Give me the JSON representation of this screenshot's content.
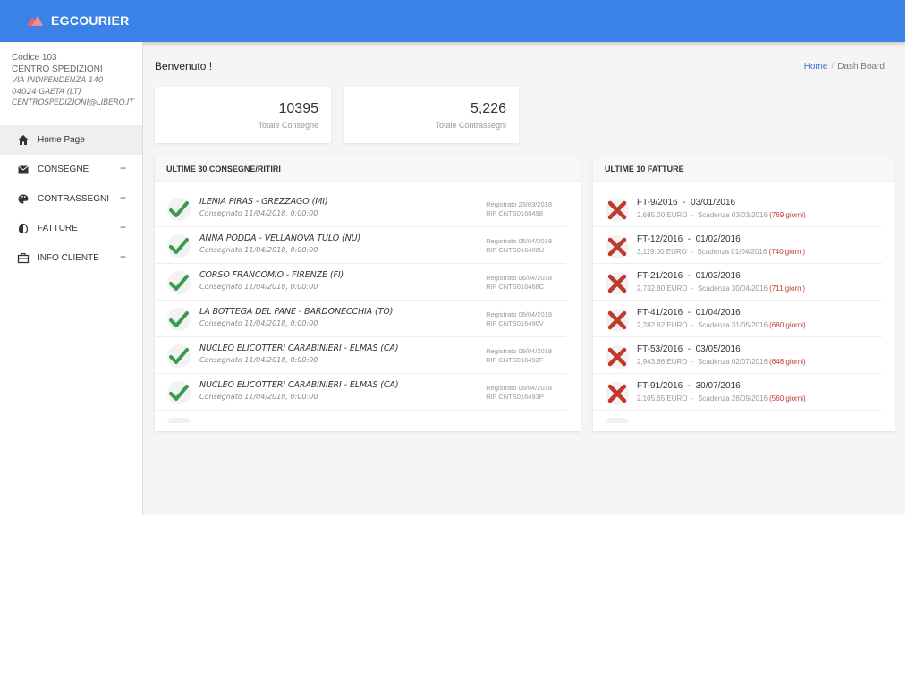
{
  "header": {
    "brand": "EGCOURIER"
  },
  "client": {
    "code": "Codice 103",
    "name": "CENTRO SPEDIZIONI",
    "address": "VIA INDIPENDENZA 140",
    "city": "04024 GAETA (LT)",
    "email": "CENTROSPEDIZIONI@LIBERO.IT"
  },
  "sidebar": {
    "items": [
      {
        "label": "Home Page",
        "icon": "home-icon",
        "expandable": false
      },
      {
        "label": "CONSEGNE",
        "icon": "envelope-icon",
        "expandable": true,
        "plus": "+"
      },
      {
        "label": "CONTRASSEGNI",
        "icon": "palette-icon",
        "expandable": true,
        "plus": "+"
      },
      {
        "label": "FATTURE",
        "icon": "contrast-icon",
        "expandable": true,
        "plus": "+"
      },
      {
        "label": "INFO CLIENTE",
        "icon": "briefcase-icon",
        "expandable": true,
        "plus": "+"
      }
    ]
  },
  "page": {
    "title": "Benvenuto !",
    "breadcrumb": {
      "home": "Home",
      "separator": "/",
      "current": "Dash Board"
    }
  },
  "stats": [
    {
      "value": "10395",
      "label": "Totale Consegne"
    },
    {
      "value": "5,226",
      "label": "Totale Contrassegni"
    }
  ],
  "deliveries": {
    "title": "ULTIME 30 CONSEGNE/RITIRI",
    "rows": [
      {
        "name": "ILENIA PIRAS - GREZZAGO (MI)",
        "sub": "Consegnato 11/04/2018, 0:00:00",
        "registered": "Registrato 23/03/2018",
        "rif": "RIF CNTS0160498"
      },
      {
        "name": "ANNA PODDA - VELLANOVA TULO (NU)",
        "sub": "Consegnato 11/04/2018, 0:00:00",
        "registered": "Registrato 05/04/2018",
        "rif": "RIF CNTS016408U"
      },
      {
        "name": "CORSO FRANCOMIO - FIRENZE (FI)",
        "sub": "Consegnato 11/04/2018, 0:00:00",
        "registered": "Registrato 06/04/2018",
        "rif": "RIF CNTS016468C"
      },
      {
        "name": "LA BOTTEGA DEL PANE - BARDONECCHIA (TO)",
        "sub": "Consegnato 11/04/2018, 0:00:00",
        "registered": "Registrato 09/04/2018",
        "rif": "RIF CNTS016490V"
      },
      {
        "name": "NUCLEO ELICOTTERI CARABINIERI - ELMAS (CA)",
        "sub": "Consegnato 11/04/2018, 0:00:00",
        "registered": "Registrato 09/04/2018",
        "rif": "RIF CNTS016492F"
      },
      {
        "name": "NUCLEO ELICOTTERI CARABINIERI - ELMAS (CA)",
        "sub": "Consegnato 11/04/2018, 0:00:00",
        "registered": "Registrato 09/04/2018",
        "rif": "RIF CNTS016493P"
      }
    ]
  },
  "invoices": {
    "title": "ULTIME 10 FATTURE",
    "rows": [
      {
        "number": "FT-9/2016",
        "date": "03/01/2016",
        "amount": "2,685.00 EURO",
        "due": "Scadenza 03/03/2016",
        "days": "(769 giorni)"
      },
      {
        "number": "FT-12/2016",
        "date": "01/02/2016",
        "amount": "3,119.00 EURO",
        "due": "Scadenza 01/04/2016",
        "days": "(740 giorni)"
      },
      {
        "number": "FT-21/2016",
        "date": "01/03/2016",
        "amount": "2,732.80 EURO",
        "due": "Scadenza 30/04/2016",
        "days": "(711 giorni)"
      },
      {
        "number": "FT-41/2016",
        "date": "01/04/2016",
        "amount": "2,282.62 EURO",
        "due": "Scadenza 31/05/2016",
        "days": "(680 giorni)"
      },
      {
        "number": "FT-53/2016",
        "date": "03/05/2016",
        "amount": "2,943.86 EURO",
        "due": "Scadenza 02/07/2016",
        "days": "(648 giorni)"
      },
      {
        "number": "FT-91/2016",
        "date": "30/07/2016",
        "amount": "2,105.65 EURO",
        "due": "Scadenza 28/09/2016",
        "days": "(560 giorni)"
      }
    ],
    "title_separator": "-",
    "sub_separator": "-"
  },
  "colors": {
    "topbar": "#3b82e8",
    "check": "#3a9b4e",
    "cross": "#c0392b",
    "days": "#c0392b",
    "link": "#3b73c4"
  }
}
